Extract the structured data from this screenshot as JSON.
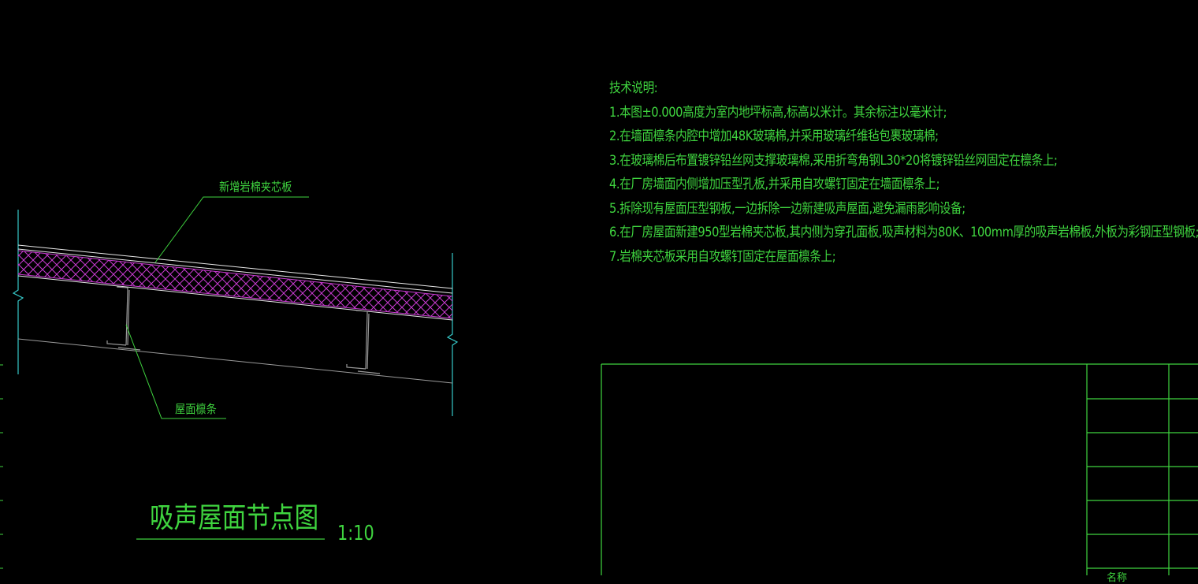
{
  "notes": {
    "heading": "技术说明:",
    "items": [
      "1.本图±0.000高度为室内地坪标高,标高以米计。其余标注以毫米计;",
      "2.在墙面檩条内腔中增加48K玻璃棉,并采用玻璃纤维毡包裹玻璃棉;",
      "3.在玻璃棉后布置镀锌铅丝网支撑玻璃棉,采用折弯角钢L30*20将镀锌铅丝网固定在檩条上;",
      "4.在厂房墙面内侧增加压型孔板,并采用自攻螺钉固定在墙面檩条上;",
      "5.拆除现有屋面压型钢板,一边拆除一边新建吸声屋面,避免漏雨影响设备;",
      "6.在厂房屋面新建950型岩棉夹芯板,其内侧为穿孔面板,吸声材料为80K、100mm厚的吸声岩棉板,外板为彩钢压型钢板;",
      "7.岩棉夹芯板采用自攻螺钉固定在屋面檩条上;"
    ]
  },
  "drawing": {
    "label_panel": "新增岩棉夹芯板",
    "label_purlin": "屋面檩条",
    "title": "吸声屋面节点图",
    "scale": "1:10"
  },
  "title_block": {
    "bottom_text": "名称"
  },
  "colors": {
    "background": "#000000",
    "annotation": "#3fd43f",
    "edge_cyan": "#35c8c8",
    "hatch_magenta": "#c93bd1",
    "outline_white": "#e8e8e8",
    "steel_gray": "#9a9a9a"
  }
}
